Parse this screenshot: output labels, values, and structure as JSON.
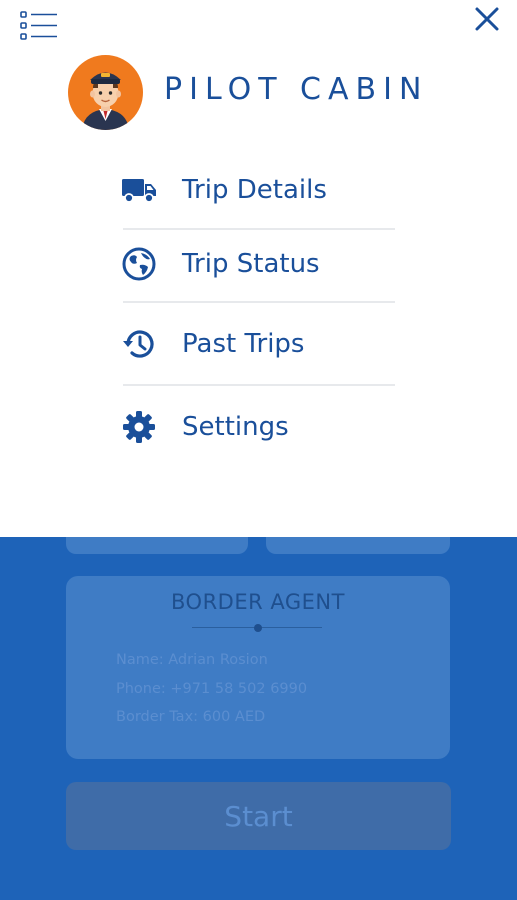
{
  "drawer": {
    "brand_title": "PILOT CABIN",
    "menu_items": [
      {
        "label": "Trip Details",
        "icon": "truck-icon"
      },
      {
        "label": "Trip Status",
        "icon": "globe-icon"
      },
      {
        "label": "Past Trips",
        "icon": "history-icon"
      },
      {
        "label": "Settings",
        "icon": "gear-icon"
      }
    ]
  },
  "background": {
    "agent_card": {
      "title": "BORDER AGENT",
      "name_line": "Name: Adrian Rosion",
      "phone_line": "Phone: +971 58 502 6990",
      "border_tax_line": "Border Tax: 600 AED"
    },
    "start_label": "Start"
  },
  "colors": {
    "brand_blue": "#1a4f9a",
    "background_blue": "#1e63b8",
    "avatar_orange": "#f07a1e"
  }
}
